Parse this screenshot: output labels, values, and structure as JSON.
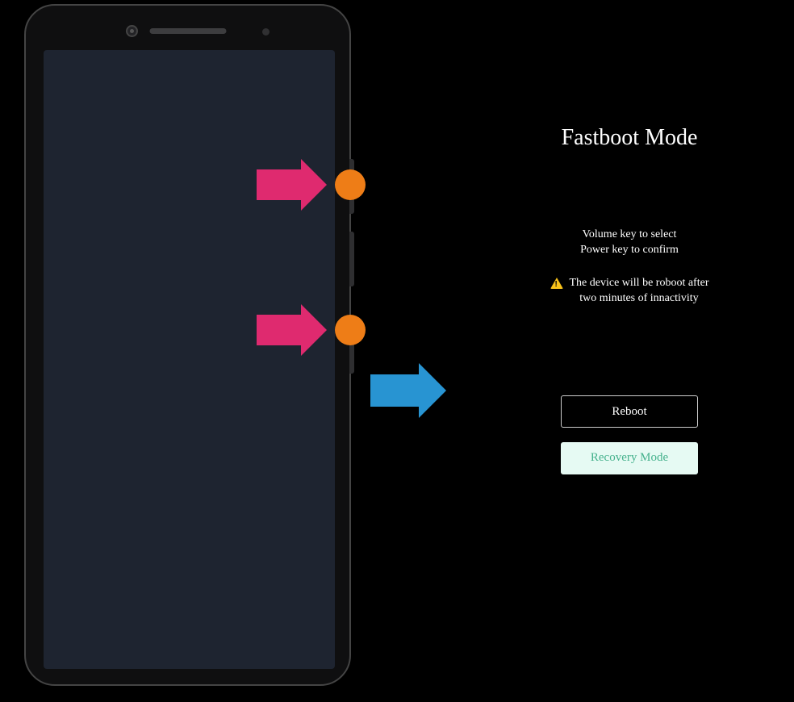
{
  "annotations": {
    "arrow_vol_up": "press-indicator",
    "arrow_power": "press-indicator",
    "arrow_result": "leads-to"
  },
  "fastboot": {
    "title": "Fastboot Mode",
    "instruction_line1": "Volume key to select",
    "instruction_line2": "Power key to confirm",
    "warning_line1": "The device will be roboot after",
    "warning_line2": "two minutes of innactivity",
    "reboot_label": "Reboot",
    "recovery_label": "Recovery Mode"
  }
}
